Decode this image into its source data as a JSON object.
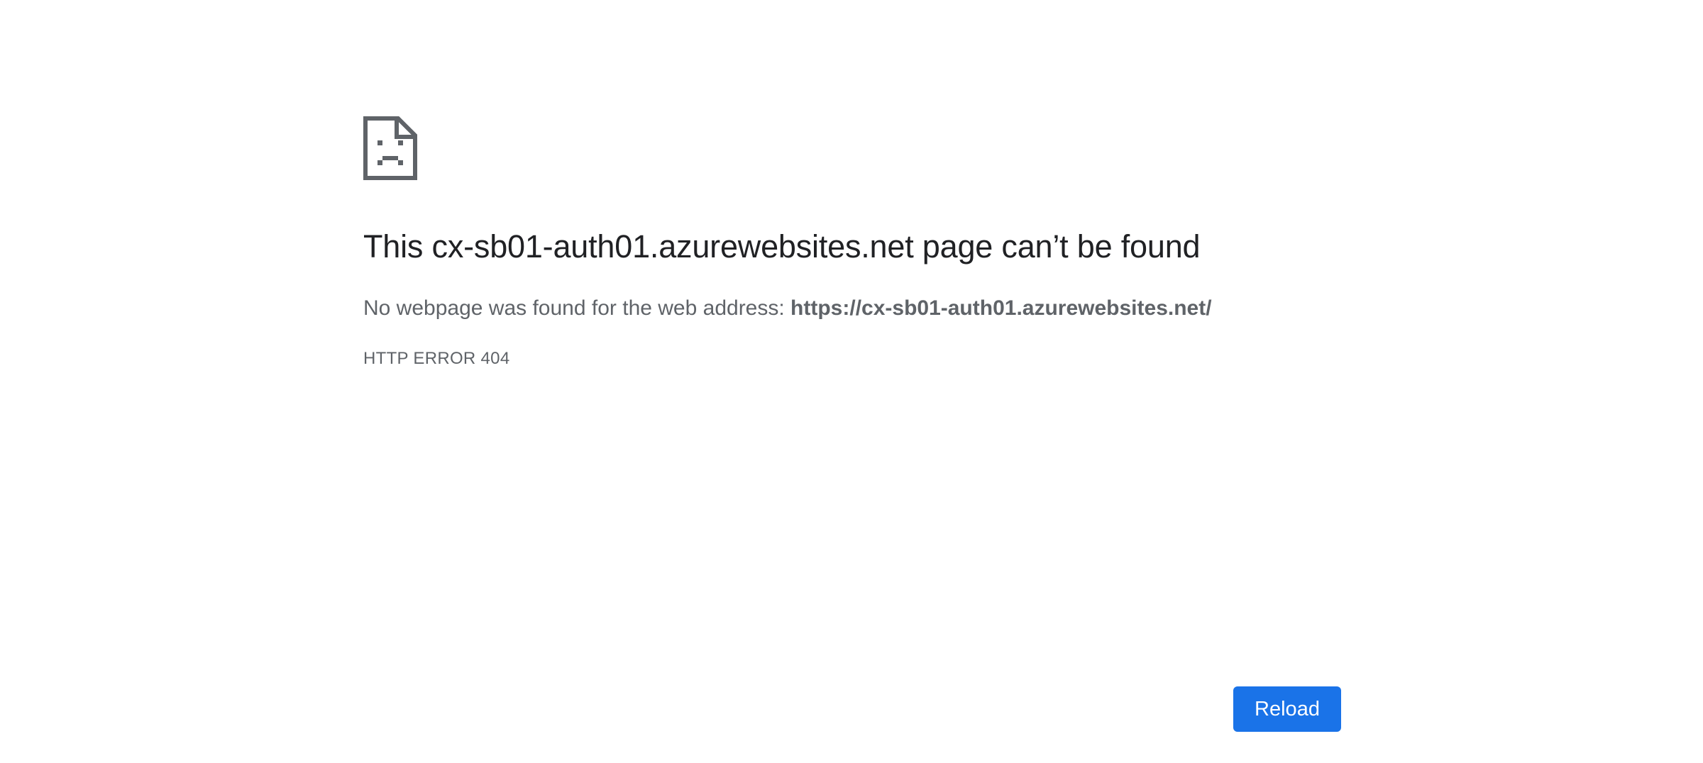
{
  "error": {
    "icon": "sad-document-icon",
    "title": "This cx-sb01-auth01.azurewebsites.net page can’t be found",
    "message_prefix": "No webpage was found for the web address: ",
    "url": "https://cx-sb01-auth01.azurewebsites.net/",
    "code": "HTTP ERROR 404"
  },
  "actions": {
    "reload_label": "Reload"
  },
  "colors": {
    "primary_button": "#1a73e8",
    "title_text": "#202124",
    "secondary_text": "#5f6368",
    "icon": "#5f6368"
  }
}
